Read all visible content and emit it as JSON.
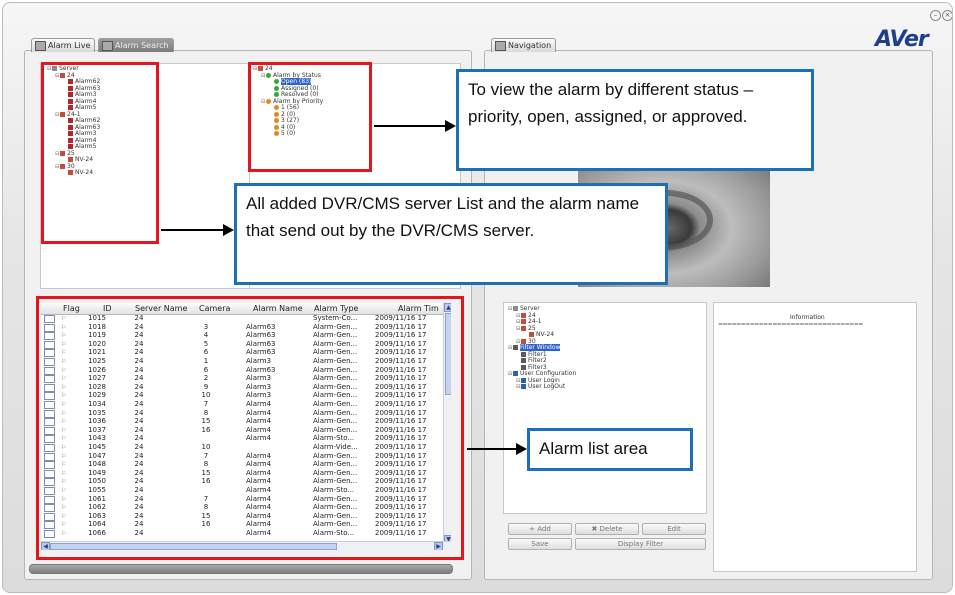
{
  "window": {
    "brand": "AVer",
    "brand_accent": "r",
    "min_btn": "–",
    "close_btn": "×"
  },
  "tabs": [
    {
      "label": "Alarm Live",
      "active": true
    },
    {
      "label": "Alarm Search",
      "active": false
    },
    {
      "label": "Navigation",
      "active": true
    }
  ],
  "server_tree": [
    {
      "label": "Server",
      "level": 0,
      "icon": "server-icon"
    },
    {
      "label": "24",
      "level": 1,
      "icon": "dvr-icon"
    },
    {
      "label": "Alarm62",
      "level": 2,
      "icon": "alarm-icon"
    },
    {
      "label": "Alarm63",
      "level": 2,
      "icon": "alarm-icon"
    },
    {
      "label": "Alarm3",
      "level": 2,
      "icon": "alarm-icon"
    },
    {
      "label": "Alarm4",
      "level": 2,
      "icon": "alarm-icon"
    },
    {
      "label": "Alarm5",
      "level": 2,
      "icon": "alarm-icon"
    },
    {
      "label": "24-1",
      "level": 1,
      "icon": "dvr-icon"
    },
    {
      "label": "Alarm62",
      "level": 2,
      "icon": "alarm-icon"
    },
    {
      "label": "Alarm63",
      "level": 2,
      "icon": "alarm-icon"
    },
    {
      "label": "Alarm3",
      "level": 2,
      "icon": "alarm-icon"
    },
    {
      "label": "Alarm4",
      "level": 2,
      "icon": "alarm-icon"
    },
    {
      "label": "Alarm5",
      "level": 2,
      "icon": "alarm-icon"
    },
    {
      "label": "25",
      "level": 1,
      "icon": "dvr-icon"
    },
    {
      "label": "NV-24",
      "level": 2,
      "icon": "dvr-icon"
    },
    {
      "label": "30",
      "level": 1,
      "icon": "dvr-icon"
    },
    {
      "label": "NV-24",
      "level": 2,
      "icon": "dvr-icon"
    }
  ],
  "status_tree": [
    {
      "label": "24",
      "level": 0,
      "icon": "dvr-icon"
    },
    {
      "label": "Alarm by Status",
      "level": 1,
      "icon": "status-icon"
    },
    {
      "label": "Open (83)",
      "level": 2,
      "icon": "status-icon",
      "selected": true
    },
    {
      "label": "Assigned (0)",
      "level": 2,
      "icon": "status-icon"
    },
    {
      "label": "Resolved (0)",
      "level": 2,
      "icon": "status-icon"
    },
    {
      "label": "Alarm by Priority",
      "level": 1,
      "icon": "priority-icon"
    },
    {
      "label": "1 (56)",
      "level": 2,
      "icon": "priority-icon"
    },
    {
      "label": "2 (0)",
      "level": 2,
      "icon": "priority-icon"
    },
    {
      "label": "3 (27)",
      "level": 2,
      "icon": "priority-icon"
    },
    {
      "label": "4 (0)",
      "level": 2,
      "icon": "priority-icon"
    },
    {
      "label": "5 (0)",
      "level": 2,
      "icon": "priority-icon"
    }
  ],
  "nav_tree": [
    {
      "label": "Server",
      "level": 0,
      "icon": "server-icon"
    },
    {
      "label": "24",
      "level": 1,
      "icon": "dvr-icon"
    },
    {
      "label": "24-1",
      "level": 1,
      "icon": "dvr-icon"
    },
    {
      "label": "25",
      "level": 1,
      "icon": "dvr-icon"
    },
    {
      "label": "NV-24",
      "level": 2,
      "icon": "dvr-icon"
    },
    {
      "label": "30",
      "level": 1,
      "icon": "dvr-icon"
    },
    {
      "label": "Filter Window",
      "level": 0,
      "icon": "filter-icon",
      "selected": true
    },
    {
      "label": "Filter1",
      "level": 1,
      "icon": "filter-icon"
    },
    {
      "label": "Filter2",
      "level": 1,
      "icon": "filter-icon"
    },
    {
      "label": "Filter3",
      "level": 1,
      "icon": "filter-icon"
    },
    {
      "label": "User Configuration",
      "level": 0,
      "icon": "user-icon"
    },
    {
      "label": "User Login",
      "level": 1,
      "icon": "user-icon"
    },
    {
      "label": "User LogOut",
      "level": 1,
      "icon": "user-icon"
    }
  ],
  "nav_buttons": [
    {
      "label": "Add"
    },
    {
      "label": "Delete"
    },
    {
      "label": "Edit"
    },
    {
      "label": "Save"
    },
    {
      "label": "Display Filter"
    }
  ],
  "info": {
    "title": "Information",
    "separator": "================================"
  },
  "alarm_table": {
    "columns": [
      "Flag",
      "ID",
      "Server Name",
      "Camera",
      "Alarm Name",
      "Alarm Type",
      "Alarm Tim"
    ],
    "rows": [
      [
        "1015",
        "24",
        "",
        "",
        "System-Co...",
        "2009/11/16 17"
      ],
      [
        "1018",
        "24",
        "3",
        "Alarm63",
        "Alarm-Gen...",
        "2009/11/16 17"
      ],
      [
        "1019",
        "24",
        "4",
        "Alarm63",
        "Alarm-Gen...",
        "2009/11/16 17"
      ],
      [
        "1020",
        "24",
        "5",
        "Alarm63",
        "Alarm-Gen...",
        "2009/11/16 17"
      ],
      [
        "1021",
        "24",
        "6",
        "Alarm63",
        "Alarm-Gen...",
        "2009/11/16 17"
      ],
      [
        "1025",
        "24",
        "1",
        "Alarm3",
        "Alarm-Gen...",
        "2009/11/16 17"
      ],
      [
        "1026",
        "24",
        "6",
        "Alarm63",
        "Alarm-Gen...",
        "2009/11/16 17"
      ],
      [
        "1027",
        "24",
        "2",
        "Alarm3",
        "Alarm-Gen...",
        "2009/11/16 17"
      ],
      [
        "1028",
        "24",
        "9",
        "Alarm3",
        "Alarm-Gen...",
        "2009/11/16 17"
      ],
      [
        "1029",
        "24",
        "10",
        "Alarm3",
        "Alarm-Gen...",
        "2009/11/16 17"
      ],
      [
        "1034",
        "24",
        "7",
        "Alarm4",
        "Alarm-Gen...",
        "2009/11/16 17"
      ],
      [
        "1035",
        "24",
        "8",
        "Alarm4",
        "Alarm-Gen...",
        "2009/11/16 17"
      ],
      [
        "1036",
        "24",
        "15",
        "Alarm4",
        "Alarm-Gen...",
        "2009/11/16 17"
      ],
      [
        "1037",
        "24",
        "16",
        "Alarm4",
        "Alarm-Gen...",
        "2009/11/16 17"
      ],
      [
        "1043",
        "24",
        "",
        "Alarm4",
        "Alarm-Sto...",
        "2009/11/16 17"
      ],
      [
        "1045",
        "24",
        "10",
        "",
        "Alarm-Vide...",
        "2009/11/16 17"
      ],
      [
        "1047",
        "24",
        "7",
        "Alarm4",
        "Alarm-Gen...",
        "2009/11/16 17"
      ],
      [
        "1048",
        "24",
        "8",
        "Alarm4",
        "Alarm-Gen...",
        "2009/11/16 17"
      ],
      [
        "1049",
        "24",
        "15",
        "Alarm4",
        "Alarm-Gen...",
        "2009/11/16 17"
      ],
      [
        "1050",
        "24",
        "16",
        "Alarm4",
        "Alarm-Gen...",
        "2009/11/16 17"
      ],
      [
        "1055",
        "24",
        "",
        "Alarm4",
        "Alarm-Sto...",
        "2009/11/16 17"
      ],
      [
        "1061",
        "24",
        "7",
        "Alarm4",
        "Alarm-Gen...",
        "2009/11/16 17"
      ],
      [
        "1062",
        "24",
        "8",
        "Alarm4",
        "Alarm-Gen...",
        "2009/11/16 17"
      ],
      [
        "1063",
        "24",
        "15",
        "Alarm4",
        "Alarm-Gen...",
        "2009/11/16 17"
      ],
      [
        "1064",
        "24",
        "16",
        "Alarm4",
        "Alarm-Gen...",
        "2009/11/16 17"
      ],
      [
        "1066",
        "24",
        "",
        "Alarm4",
        "Alarm-Sto...",
        "2009/11/16 17"
      ]
    ]
  },
  "callouts": {
    "status": "To view the alarm by different status – priority, open, assigned, or approved.",
    "server": "All added DVR/CMS server List and the alarm name that send out by the DVR/CMS server.",
    "list": "Alarm list area"
  },
  "colors": {
    "highlight_box": "#e3161d",
    "callout_border": "#1e6fb8",
    "brand": "#1d3f8a",
    "brand_accent": "#d11f26"
  }
}
